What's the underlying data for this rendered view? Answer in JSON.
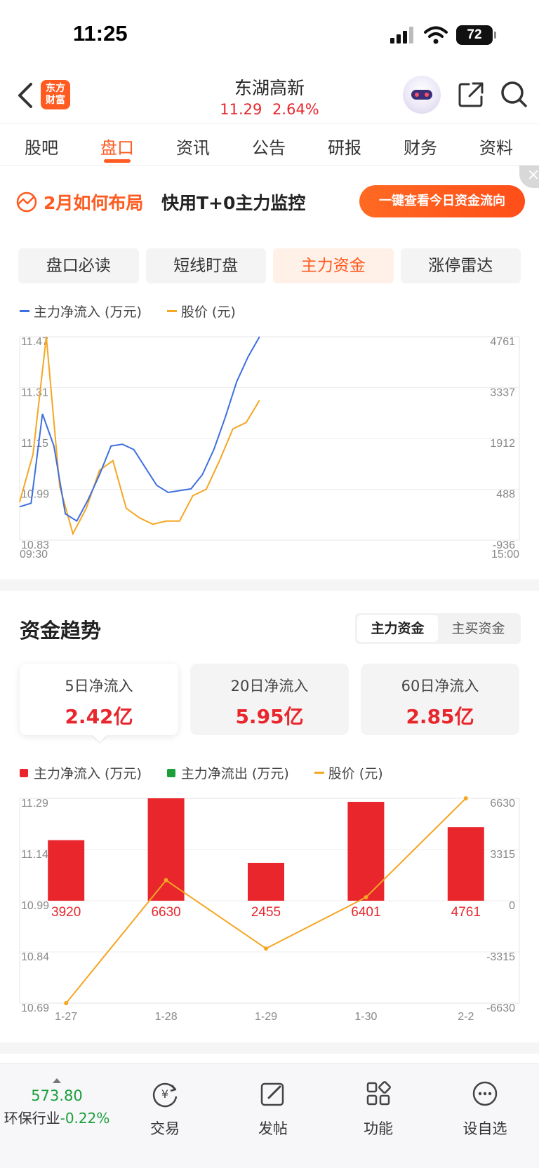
{
  "status_bar": {
    "time": "11:25",
    "battery": "72"
  },
  "header": {
    "logo_line1": "东方",
    "logo_line2": "财富",
    "stock_name": "东湖高新",
    "price": "11.29",
    "change_pct": "2.64%",
    "price_color": "#e8262c"
  },
  "tabs": [
    "股吧",
    "盘口",
    "资讯",
    "公告",
    "研报",
    "财务",
    "资料"
  ],
  "active_tab": "盘口",
  "banner": {
    "title": "2月如何布局",
    "subtitle": "快用T+0主力监控",
    "button": "一键查看今日资金流向",
    "close": "×"
  },
  "segments": [
    "盘口必读",
    "短线盯盘",
    "主力资金",
    "涨停雷达"
  ],
  "active_segment": "主力资金",
  "intraday_legend": {
    "net_inflow": "主力净流入 (万元)",
    "price": "股价 (元)"
  },
  "colors": {
    "accent": "#ff5a1f",
    "up": "#e8262c",
    "down": "#1a9f3a",
    "blue_line": "#3d6fe0",
    "orange_line": "#f5a623"
  },
  "trend": {
    "title": "资金趋势",
    "toggle": [
      "主力资金",
      "主买资金"
    ],
    "active_toggle": "主力资金",
    "cards": [
      {
        "label": "5日净流入",
        "value": "2.42亿"
      },
      {
        "label": "20日净流入",
        "value": "5.95亿"
      },
      {
        "label": "60日净流入",
        "value": "2.85亿"
      }
    ],
    "legend": {
      "inflow": "主力净流入 (万元)",
      "outflow": "主力净流出 (万元)",
      "price": "股价 (元)"
    }
  },
  "chart_data": [
    {
      "type": "line",
      "x_start": "09:30",
      "x_end": "15:00",
      "left_ticks": [
        "11.47",
        "11.31",
        "11.15",
        "10.99",
        "10.83"
      ],
      "right_ticks": [
        "4761",
        "3337",
        "1912",
        "488",
        "-936"
      ],
      "ylim_left": [
        10.83,
        11.47
      ],
      "ylim_right": [
        -936,
        4761
      ],
      "grid": true,
      "series": [
        {
          "name": "主力净流入 (万元)",
          "axis": "right",
          "values": [
            0,
            100,
            2600,
            1700,
            -200,
            -400,
            200,
            900,
            1700,
            1750,
            1600,
            1100,
            600,
            400,
            450,
            500,
            900,
            1600,
            2500,
            3500,
            4200,
            4761
          ]
        },
        {
          "name": "股价 (元)",
          "axis": "left",
          "values": [
            10.95,
            11.1,
            11.47,
            11.0,
            10.85,
            10.93,
            11.05,
            11.08,
            10.93,
            10.9,
            10.88,
            10.89,
            10.89,
            10.97,
            10.99,
            11.08,
            11.18,
            11.2,
            11.27
          ]
        }
      ]
    },
    {
      "type": "bar",
      "categories": [
        "1-27",
        "1-28",
        "1-29",
        "1-30",
        "2-2"
      ],
      "left_ticks": [
        "11.29",
        "11.14",
        "10.99",
        "10.84",
        "10.69"
      ],
      "right_ticks": [
        "6630",
        "3315",
        "0",
        "-3315",
        "-6630"
      ],
      "ylim_left": [
        10.69,
        11.29
      ],
      "ylim_right": [
        -6630,
        6630
      ],
      "series": [
        {
          "name": "主力净流入 (万元)",
          "values": [
            3920,
            6630,
            2455,
            6401,
            4761
          ]
        },
        {
          "name": "股价 (元)",
          "values": [
            10.69,
            11.05,
            10.85,
            11.0,
            11.29
          ]
        }
      ],
      "data_labels": [
        "3920",
        "6630",
        "2455",
        "6401",
        "4761"
      ]
    }
  ],
  "bottom_bar": {
    "index_value": "573.80",
    "sector": "环保行业",
    "sector_change": "-0.22%",
    "items": [
      "交易",
      "发帖",
      "功能",
      "设自选"
    ]
  }
}
